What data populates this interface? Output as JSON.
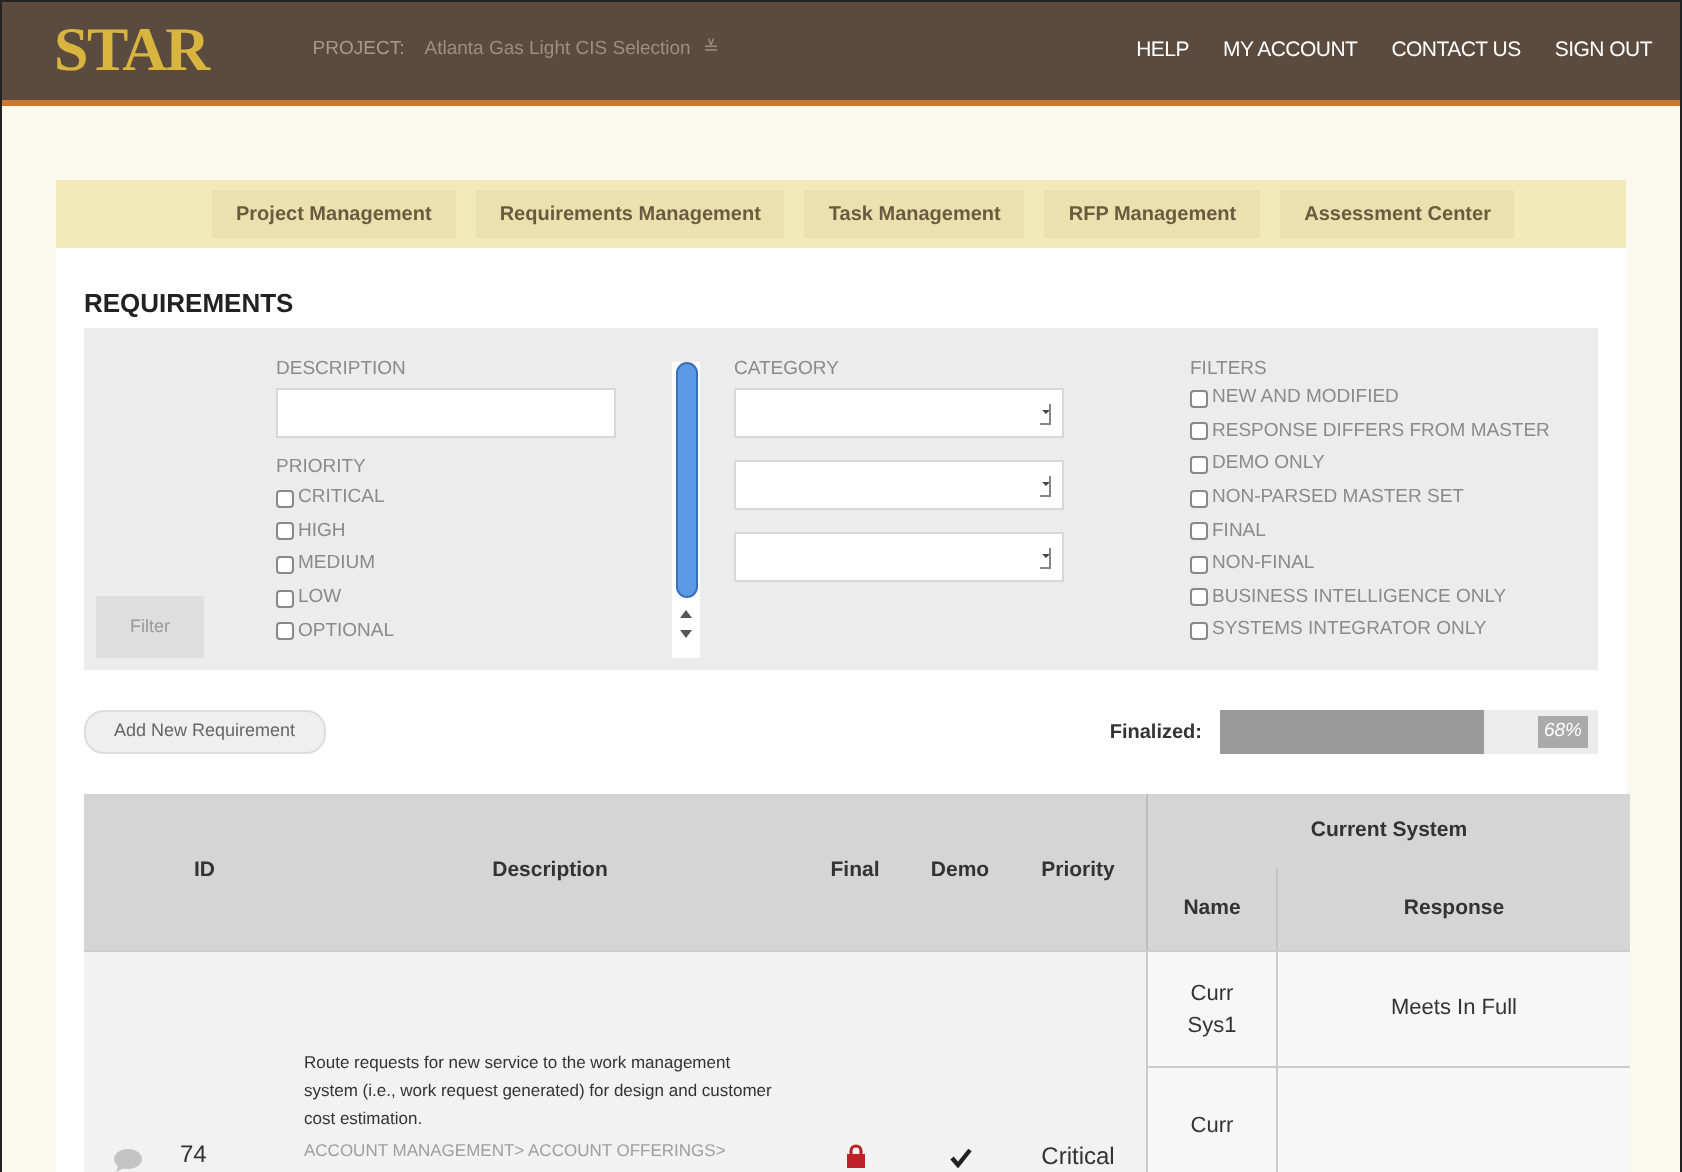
{
  "header": {
    "logo": "STAR",
    "project_label": "PROJECT:",
    "project_name": "Atlanta Gas Light CIS Selection",
    "project_caret": "≚",
    "links": [
      "HELP",
      "MY ACCOUNT",
      "CONTACT US",
      "SIGN OUT"
    ]
  },
  "nav_tabs": [
    {
      "label": "Project Management",
      "selected": false
    },
    {
      "label": "Requirements Management",
      "selected": false
    },
    {
      "label": "Task Management",
      "selected": false
    },
    {
      "label": "RFP Management",
      "selected": false
    },
    {
      "label": "Assessment Center",
      "selected": false
    }
  ],
  "page_title": "REQUIREMENTS",
  "filter_panel": {
    "filter_button": "Filter",
    "description_label": "DESCRIPTION",
    "priority_label": "PRIORITY",
    "priorities": [
      {
        "label": "CRITICAL",
        "checked": false
      },
      {
        "label": "HIGH",
        "checked": false
      },
      {
        "label": "MEDIUM",
        "checked": false
      },
      {
        "label": "LOW",
        "checked": false
      },
      {
        "label": "OPTIONAL",
        "checked": false
      }
    ],
    "category_label": "CATEGORY",
    "filters_label": "FILTERS",
    "filters": [
      {
        "label": "NEW AND MODIFIED",
        "checked": false
      },
      {
        "label": "RESPONSE DIFFERS FROM MASTER",
        "checked": false
      },
      {
        "label": "DEMO ONLY",
        "checked": false
      },
      {
        "label": "NON-PARSED MASTER SET",
        "checked": false
      },
      {
        "label": "FINAL",
        "checked": false
      },
      {
        "label": "NON-FINAL",
        "checked": false
      },
      {
        "label": "BUSINESS INTELLIGENCE ONLY",
        "checked": false
      },
      {
        "label": "SYSTEMS INTEGRATOR ONLY",
        "checked": false
      }
    ]
  },
  "add_button": "Add New Requirement",
  "finalized": {
    "label": "Finalized:",
    "level": 0.7,
    "reading": "68%"
  },
  "table": {
    "columns": [
      "ID",
      "Description",
      "Final",
      "Demo",
      "Priority"
    ],
    "group_header": "Current System",
    "sub_columns": [
      "Name",
      "Response"
    ],
    "rows": [
      {
        "id": "74",
        "description": "Route requests for new service to the work management system (i.e., work request generated) for design and customer cost estimation.",
        "category": "ACCOUNT MANAGEMENT> ACCOUNT OFFERINGS>",
        "final": true,
        "demo": true,
        "priority": "Critical",
        "systems": [
          {
            "name": "Curr Sys1",
            "response": "Meets In Full"
          },
          {
            "name": "Curr"
          }
        ]
      }
    ]
  }
}
